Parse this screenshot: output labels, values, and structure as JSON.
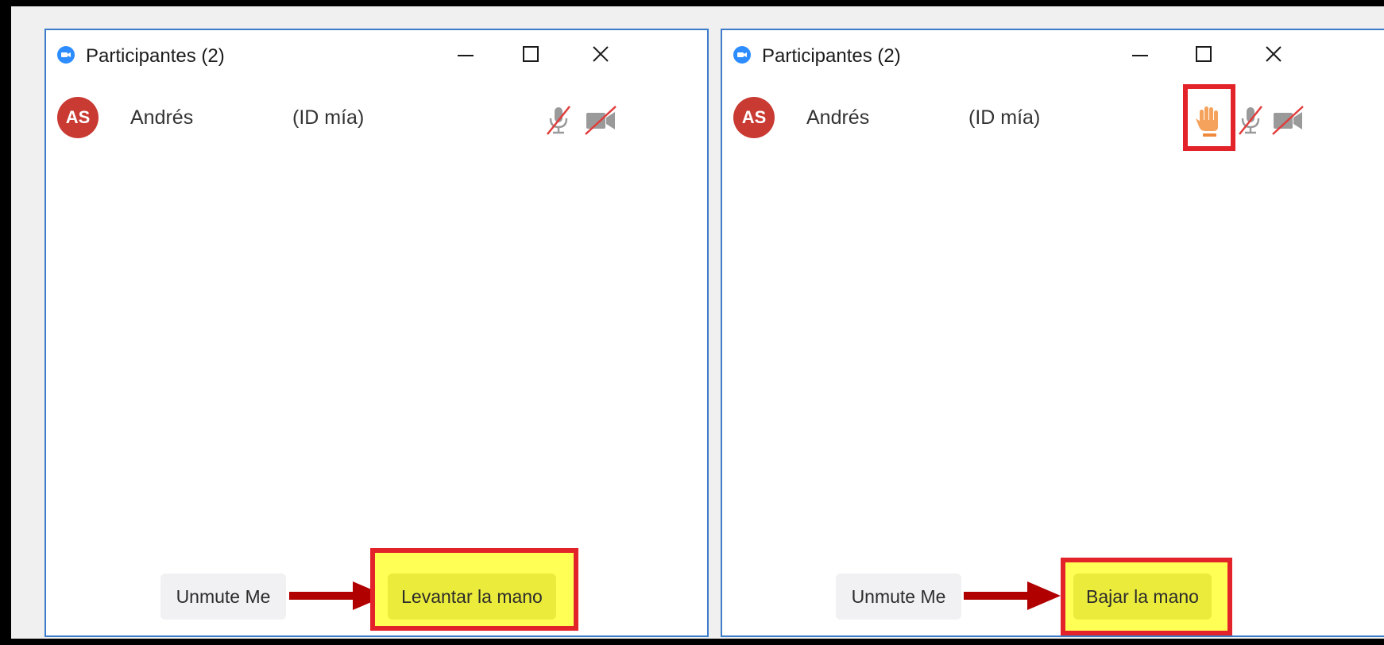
{
  "colors": {
    "window_border": "#3d7cc9",
    "avatar_bg": "#c93a33",
    "highlight_red": "#e3232a",
    "highlight_yellow": "#ffff55",
    "arrow_red": "#b00000",
    "raised_hand": "#f5a25d"
  },
  "windows": [
    {
      "title": "Participantes (2)",
      "participant": {
        "initials": "AS",
        "name": "Andrés",
        "tag": "(ID mía)",
        "hand_raised": false
      },
      "buttons": {
        "unmute": "Unmute Me",
        "hand": "Levantar la mano"
      },
      "icons": [
        "zoom-logo-icon",
        "minimize-icon",
        "maximize-icon",
        "close-icon",
        "mic-muted-icon",
        "video-off-icon",
        "arrow-right-icon"
      ]
    },
    {
      "title": "Participantes (2)",
      "participant": {
        "initials": "AS",
        "name": "Andrés",
        "tag": "(ID mía)",
        "hand_raised": true
      },
      "buttons": {
        "unmute": "Unmute Me",
        "hand": "Bajar la mano"
      },
      "icons": [
        "zoom-logo-icon",
        "minimize-icon",
        "maximize-icon",
        "close-icon",
        "raised-hand-icon",
        "mic-muted-icon",
        "video-off-icon",
        "arrow-right-icon"
      ]
    }
  ]
}
